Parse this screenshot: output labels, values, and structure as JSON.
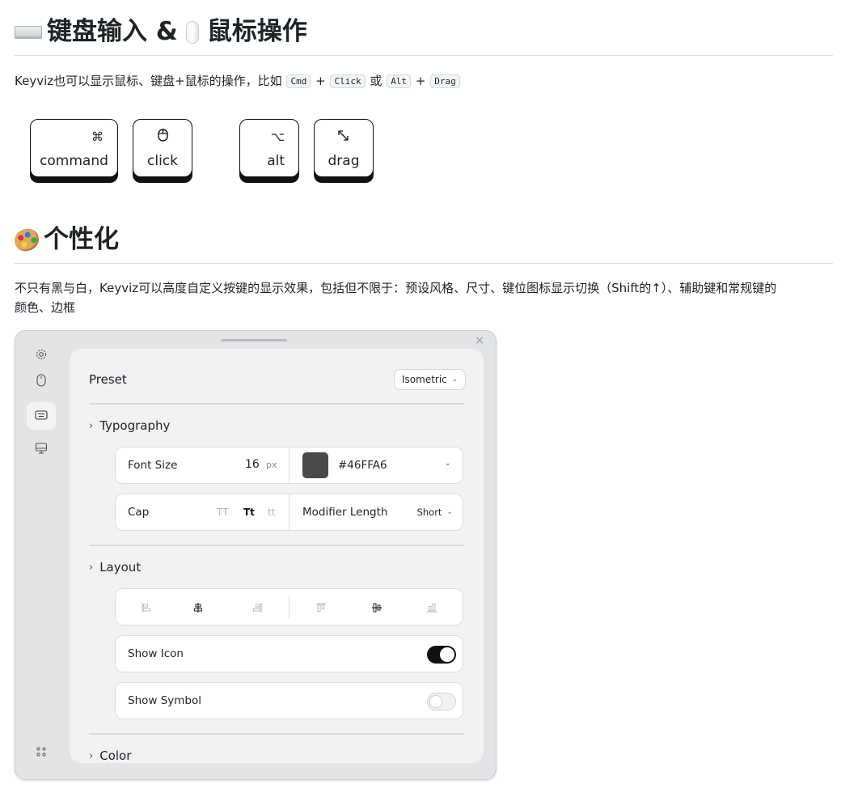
{
  "section1": {
    "title": "键盘输入 & 鼠标操作",
    "title_part1": "键盘输入 &",
    "title_part2": "鼠标操作",
    "desc_prefix": "Keyviz也可以显示鼠标、键盘+鼠标的操作，比如",
    "code_cmd": "Cmd",
    "plus": "+",
    "code_click": "Click",
    "or": "或",
    "code_alt": "Alt",
    "code_drag": "Drag"
  },
  "keys": [
    {
      "symbol": "⌘",
      "label": "command"
    },
    {
      "symbol": "🖱",
      "label": "click"
    },
    {
      "symbol": "⌥",
      "label": "alt"
    },
    {
      "symbol": "⤡",
      "label": "drag"
    }
  ],
  "section2": {
    "title": "个性化",
    "desc_line1": "不只有黑与白，Keyviz可以高度自定义按键的显示效果，包括但不限于：预设风格、尺寸、键位图标显示切换（Shift的↑）、辅助键和常规键的",
    "desc_line2": "颜色、边框"
  },
  "panel": {
    "close_glyph": "×",
    "sidebar_icons": [
      "gear-icon",
      "mouse-icon",
      "keyboard-icon",
      "monitor-icon",
      "dots-grid-icon"
    ],
    "preset_label": "Preset",
    "preset_value": "Isometric",
    "typography_label": "Typography",
    "font_size_label": "Font Size",
    "font_size_value": "16",
    "font_size_unit": "px",
    "color_hex": "#46FFA6",
    "cap_label": "Cap",
    "cap_options": [
      "TT",
      "Tt",
      "tt"
    ],
    "cap_selected": "Tt",
    "modifier_length_label": "Modifier Length",
    "modifier_length_value": "Short",
    "layout_label": "Layout",
    "show_icon_label": "Show Icon",
    "show_icon_on": true,
    "show_symbol_label": "Show Symbol",
    "show_symbol_on": false,
    "color_label": "Color"
  },
  "colors": {
    "swatch": "#4a4a4a",
    "panel_bg": "#e3e4e6",
    "card_bg": "#f2f2f3",
    "toggle_on": "#111111"
  }
}
